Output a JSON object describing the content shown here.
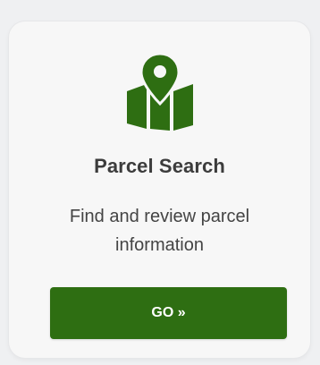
{
  "card": {
    "icon": "map-pin-icon",
    "title": "Parcel Search",
    "description": "Find and review parcel information",
    "button_label": "GO »"
  },
  "colors": {
    "accent": "#2e6e12",
    "background": "#eff0f2",
    "card": "#f7f7f7",
    "title_text": "#3c3c3c",
    "body_text": "#444444"
  }
}
